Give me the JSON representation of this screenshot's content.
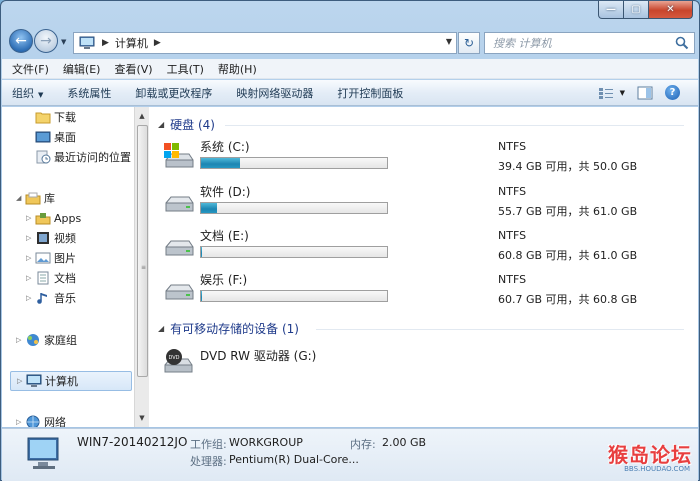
{
  "window": {
    "caption": {
      "minimize": "—",
      "maximize": "▢",
      "close": "✕"
    }
  },
  "nav": {
    "address_path": "计算机",
    "search_placeholder": "搜索 计算机"
  },
  "menu": [
    "文件(F)",
    "编辑(E)",
    "查看(V)",
    "工具(T)",
    "帮助(H)"
  ],
  "commands": {
    "organize": "组织",
    "items": [
      "系统属性",
      "卸载或更改程序",
      "映射网络驱动器",
      "打开控制面板"
    ]
  },
  "sidebar": {
    "items": [
      {
        "label": "下载",
        "icon": "folder-icon"
      },
      {
        "label": "桌面",
        "icon": "desktop-icon"
      },
      {
        "label": "最近访问的位置",
        "icon": "recent-places-icon"
      },
      {
        "label": "库",
        "icon": "library-icon"
      },
      {
        "label": "Apps",
        "icon": "apps-library-icon"
      },
      {
        "label": "视频",
        "icon": "video-library-icon"
      },
      {
        "label": "图片",
        "icon": "pictures-library-icon"
      },
      {
        "label": "文档",
        "icon": "documents-library-icon"
      },
      {
        "label": "音乐",
        "icon": "music-library-icon"
      },
      {
        "label": "家庭组",
        "icon": "homegroup-icon"
      },
      {
        "label": "计算机",
        "icon": "computer-icon"
      },
      {
        "label": "网络",
        "icon": "network-icon"
      }
    ]
  },
  "groups": {
    "hard_disks": "硬盘 (4)",
    "removable": "有可移动存储的设备 (1)"
  },
  "drives": [
    {
      "name": "系统 (C:)",
      "fs": "NTFS",
      "space": "39.4 GB 可用，共 50.0 GB",
      "used_fraction": 0.212,
      "icon": "system-drive-icon"
    },
    {
      "name": "软件 (D:)",
      "fs": "NTFS",
      "space": "55.7 GB 可用，共 61.0 GB",
      "used_fraction": 0.087,
      "icon": "hard-drive-icon"
    },
    {
      "name": "文档 (E:)",
      "fs": "NTFS",
      "space": "60.8 GB 可用，共 61.0 GB",
      "used_fraction": 0.003,
      "icon": "hard-drive-icon"
    },
    {
      "name": "娱乐 (F:)",
      "fs": "NTFS",
      "space": "60.7 GB 可用，共 60.8 GB",
      "used_fraction": 0.002,
      "icon": "hard-drive-icon"
    }
  ],
  "dvd": {
    "name": "DVD RW 驱动器 (G:)",
    "icon_label": "DVD"
  },
  "details": {
    "computer_name": "WIN7-20140212JO",
    "workgroup_label": "工作组:",
    "workgroup_value": "WORKGROUP",
    "memory_label": "内存:",
    "memory_value": "2.00 GB",
    "processor_label": "处理器:",
    "processor_value": "Pentium(R) Dual-Core..."
  },
  "watermark": {
    "main": "猴岛论坛",
    "sub": "BBS.HOUDAO.COM"
  },
  "colors": {
    "progress": "#2697c2",
    "group_header": "#1e3a8a"
  }
}
